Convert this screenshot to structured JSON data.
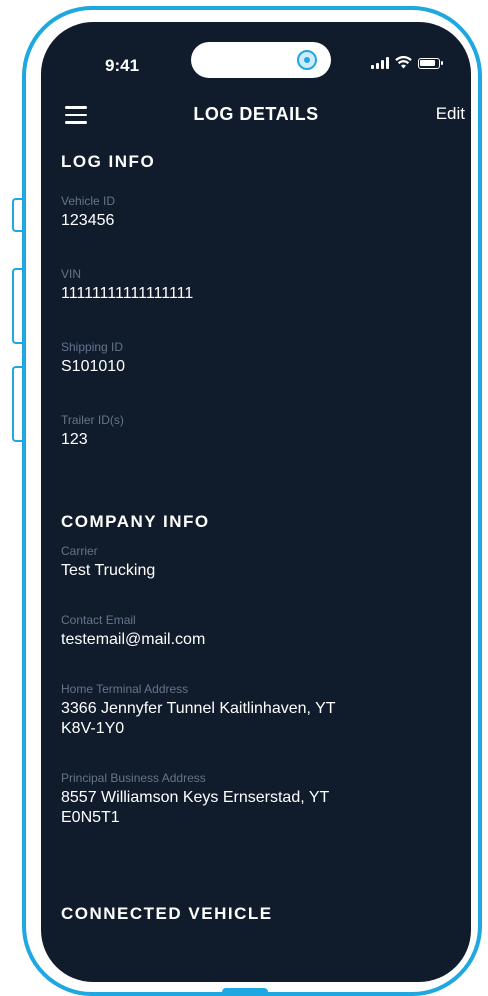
{
  "status": {
    "time": "9:41"
  },
  "header": {
    "title": "LOG DETAILS",
    "edit_label": "Edit"
  },
  "sections": [
    {
      "title": "LOG INFO",
      "fields": [
        {
          "label": "Vehicle ID",
          "value": "123456"
        },
        {
          "label": "VIN",
          "value": "11111111111111111"
        },
        {
          "label": "Shipping ID",
          "value": "S101010"
        },
        {
          "label": "Trailer ID(s)",
          "value": "123"
        }
      ]
    },
    {
      "title": "COMPANY INFO",
      "fields": [
        {
          "label": "Carrier",
          "value": "Test Trucking"
        },
        {
          "label": "Contact Email",
          "value": "testemail@mail.com"
        },
        {
          "label": "Home Terminal Address",
          "value": "3366 Jennyfer Tunnel Kaitlinhaven, YT",
          "value2": "K8V-1Y0"
        },
        {
          "label": "Principal Business Address",
          "value": "8557 Williamson Keys Ernserstad, YT",
          "value2": "E0N5T1"
        }
      ]
    },
    {
      "title": "CONNECTED VEHICLE"
    }
  ],
  "colors": {
    "frame": "#1ea7e1",
    "screen_bg": "#101c2c",
    "label": "#66748a",
    "text": "#ffffff"
  }
}
